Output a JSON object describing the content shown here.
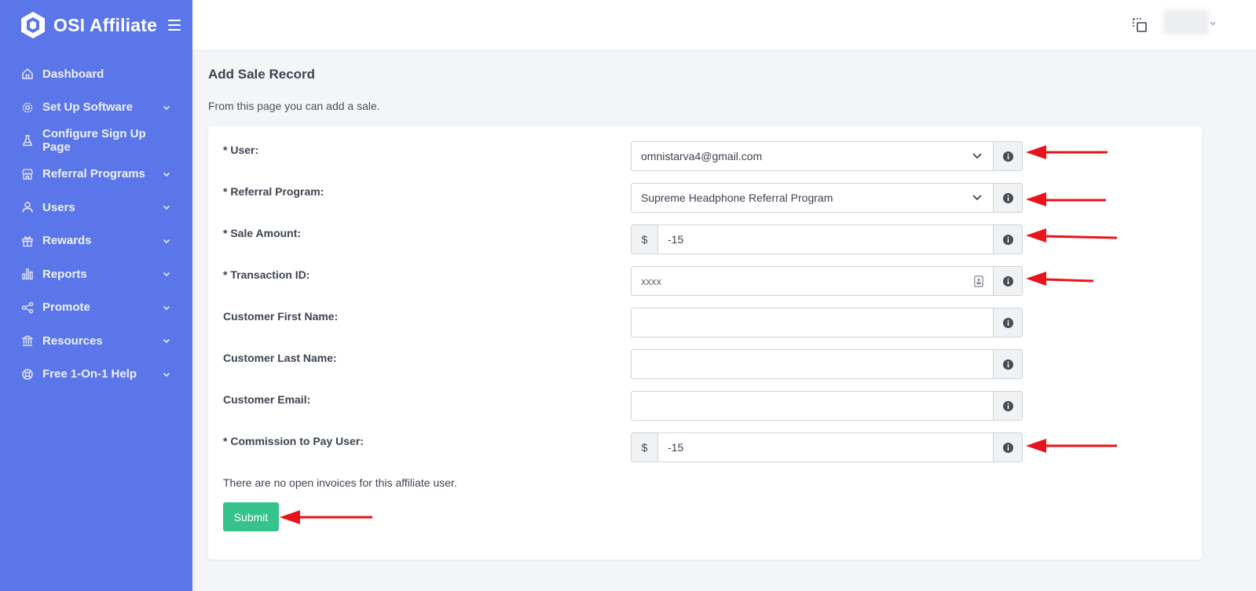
{
  "app": {
    "brand_name": "OSI Affiliate"
  },
  "sidebar": {
    "items": [
      {
        "label": "Dashboard",
        "icon": "home-icon",
        "has_chevron": false
      },
      {
        "label": "Set Up Software",
        "icon": "gear-icon",
        "has_chevron": true
      },
      {
        "label": "Configure Sign Up Page",
        "icon": "flask-icon",
        "has_chevron": false
      },
      {
        "label": "Referral Programs",
        "icon": "store-icon",
        "has_chevron": true
      },
      {
        "label": "Users",
        "icon": "user-icon",
        "has_chevron": true
      },
      {
        "label": "Rewards",
        "icon": "gift-icon",
        "has_chevron": true
      },
      {
        "label": "Reports",
        "icon": "bar-chart-icon",
        "has_chevron": true
      },
      {
        "label": "Promote",
        "icon": "share-icon",
        "has_chevron": true
      },
      {
        "label": "Resources",
        "icon": "bank-icon",
        "has_chevron": true
      },
      {
        "label": "Free 1-On-1 Help",
        "icon": "lifebuoy-icon",
        "has_chevron": true
      }
    ]
  },
  "page": {
    "title": "Add Sale Record",
    "description": "From this page you can add a sale."
  },
  "form": {
    "user": {
      "label": "* User:",
      "value": "omnistarva4@gmail.com"
    },
    "referral_program": {
      "label": "* Referral Program:",
      "value": "Supreme Headphone Referral Program"
    },
    "sale_amount": {
      "label": "* Sale Amount:",
      "prefix": "$",
      "value": "-15"
    },
    "transaction_id": {
      "label": "* Transaction ID:",
      "value": "xxxx"
    },
    "first_name": {
      "label": "Customer First Name:",
      "value": ""
    },
    "last_name": {
      "label": "Customer Last Name:",
      "value": ""
    },
    "email": {
      "label": "Customer Email:",
      "value": ""
    },
    "commission": {
      "label": "* Commission to Pay User:",
      "prefix": "$",
      "value": "-15"
    },
    "note": "There are no open invoices for this affiliate user.",
    "submit_label": "Submit"
  },
  "colors": {
    "sidebar": "#5b76e8",
    "submit": "#35c28b",
    "annotation_arrow": "#e8141b"
  }
}
